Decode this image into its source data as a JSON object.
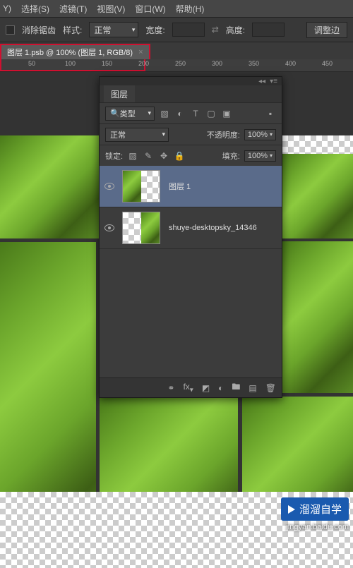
{
  "menu": {
    "items": [
      "Y)",
      "选择(S)",
      "滤镜(T)",
      "视图(V)",
      "窗口(W)",
      "帮助(H)"
    ]
  },
  "options": {
    "antialias": "消除锯齿",
    "style_label": "样式:",
    "style_value": "正常",
    "width_label": "宽度:",
    "height_label": "高度:",
    "adjust": "调整边"
  },
  "doc": {
    "tab": "图层 1.psb @ 100% (图层 1, RGB/8)"
  },
  "ruler": {
    "marks": [
      "50",
      "100",
      "150",
      "200",
      "250",
      "300",
      "350",
      "400",
      "450"
    ]
  },
  "panel": {
    "title": "图层",
    "filter": "类型",
    "blend": "正常",
    "opacity_label": "不透明度:",
    "opacity_val": "100%",
    "lock_label": "锁定:",
    "fill_label": "填充:",
    "fill_val": "100%",
    "layers": [
      {
        "name": "图层 1",
        "selected": true
      },
      {
        "name": "shuye-desktopsky_14346",
        "selected": false
      }
    ]
  },
  "watermark": {
    "brand": "溜溜自学",
    "url": "jingyan.baidu.com"
  }
}
